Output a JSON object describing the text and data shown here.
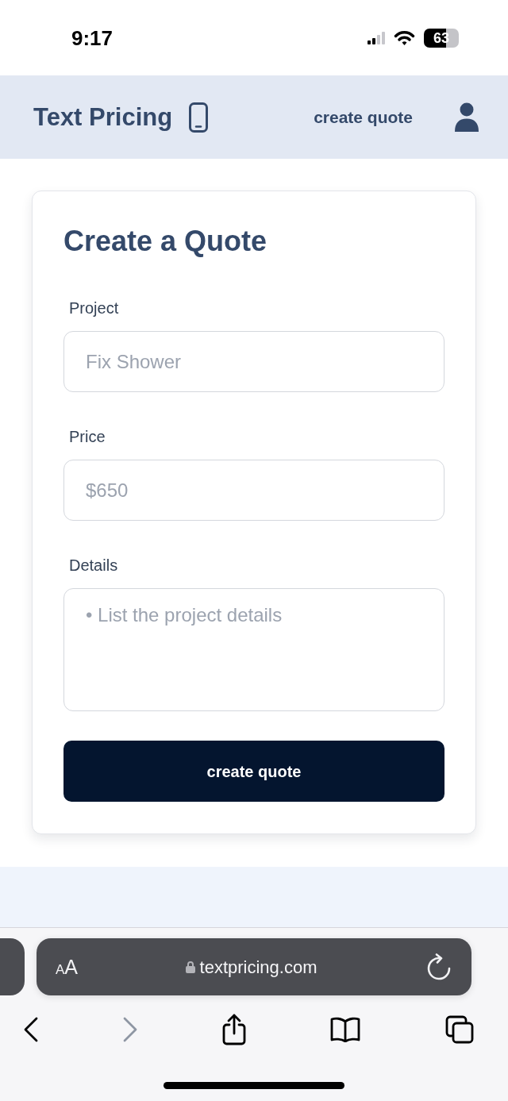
{
  "status_bar": {
    "time": "9:17",
    "battery": "63"
  },
  "navbar": {
    "brand": "Text Pricing",
    "link": "create quote"
  },
  "form": {
    "title": "Create a Quote",
    "fields": [
      {
        "kind": "input",
        "label": "Project",
        "placeholder": "Fix Shower"
      },
      {
        "kind": "input",
        "label": "Price",
        "placeholder": "$650"
      },
      {
        "kind": "textarea",
        "label": "Details",
        "placeholder": "• List the project details"
      }
    ],
    "submit": "create quote"
  },
  "browser": {
    "text_size_button": "AA",
    "url": "textpricing.com",
    "toolbar": [
      {
        "kind": "back",
        "disabled": false
      },
      {
        "kind": "forward",
        "disabled": true
      },
      {
        "kind": "share",
        "disabled": false
      },
      {
        "kind": "bookmarks",
        "disabled": false
      },
      {
        "kind": "tabs",
        "disabled": false
      }
    ]
  }
}
